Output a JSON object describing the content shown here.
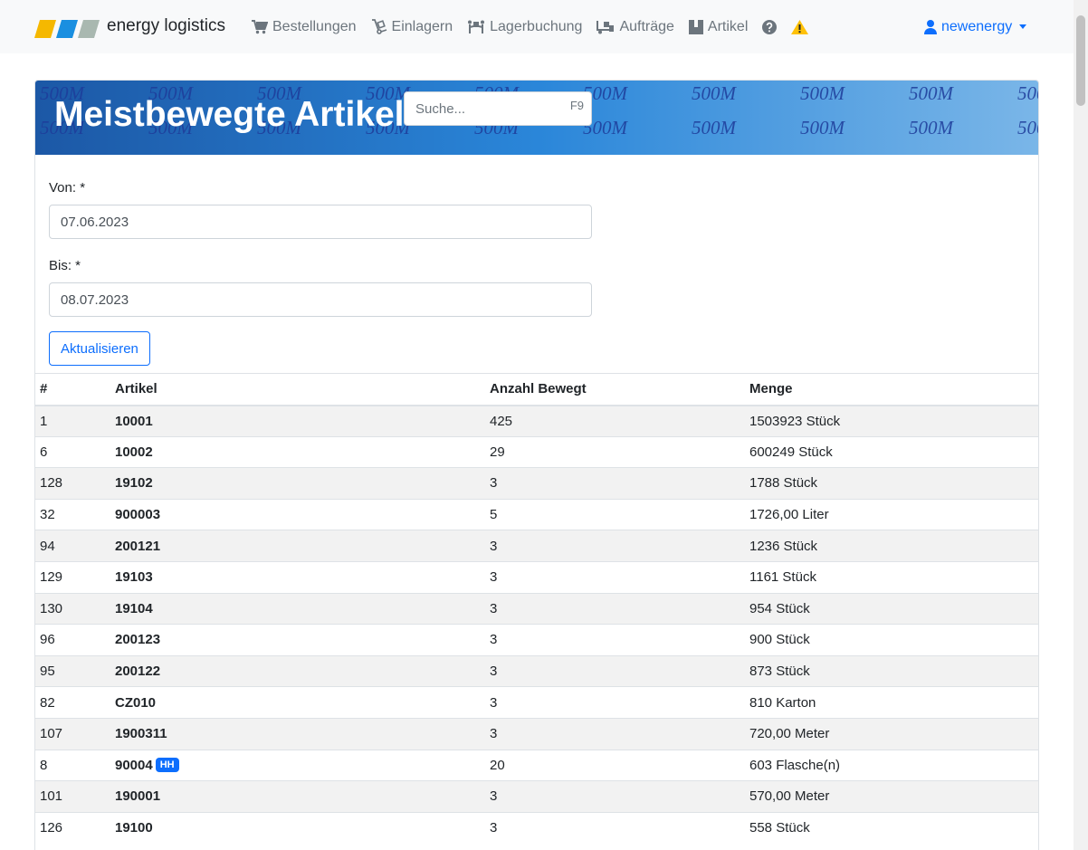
{
  "brand": {
    "name": "energy logistics",
    "colors": [
      "#f5b800",
      "#1a8fe0",
      "#a9b8b0"
    ]
  },
  "nav": [
    {
      "label": "Bestellungen",
      "icon": "cart-icon"
    },
    {
      "label": "Einlagern",
      "icon": "dolly-icon"
    },
    {
      "label": "Lagerbuchung",
      "icon": "people-carry-icon"
    },
    {
      "label": "Aufträge",
      "icon": "truck-loading-icon"
    },
    {
      "label": "Artikel",
      "icon": "box-icon"
    }
  ],
  "nav_icons": [
    "help-icon",
    "warning-icon"
  ],
  "user": {
    "name": "newenergy",
    "icon": "user-icon"
  },
  "banner": {
    "title": "Meistbewegte Artikel",
    "watermark": "500M"
  },
  "search": {
    "placeholder": "Suche...",
    "shortcut": "F9"
  },
  "form": {
    "from_label": "Von: *",
    "from_value": "07.06.2023",
    "to_label": "Bis: *",
    "to_value": "08.07.2023",
    "refresh_label": "Aktualisieren"
  },
  "table": {
    "headers": [
      "#",
      "Artikel",
      "Anzahl Bewegt",
      "Menge"
    ],
    "rows": [
      {
        "nr": "1",
        "artikel": "10001",
        "badge": "",
        "anzahl": "425",
        "menge": "1503923 Stück"
      },
      {
        "nr": "6",
        "artikel": "10002",
        "badge": "",
        "anzahl": "29",
        "menge": "600249 Stück"
      },
      {
        "nr": "128",
        "artikel": "19102",
        "badge": "",
        "anzahl": "3",
        "menge": "1788 Stück"
      },
      {
        "nr": "32",
        "artikel": "900003",
        "badge": "",
        "anzahl": "5",
        "menge": "1726,00 Liter"
      },
      {
        "nr": "94",
        "artikel": "200121",
        "badge": "",
        "anzahl": "3",
        "menge": "1236 Stück"
      },
      {
        "nr": "129",
        "artikel": "19103",
        "badge": "",
        "anzahl": "3",
        "menge": "1161 Stück"
      },
      {
        "nr": "130",
        "artikel": "19104",
        "badge": "",
        "anzahl": "3",
        "menge": "954 Stück"
      },
      {
        "nr": "96",
        "artikel": "200123",
        "badge": "",
        "anzahl": "3",
        "menge": "900 Stück"
      },
      {
        "nr": "95",
        "artikel": "200122",
        "badge": "",
        "anzahl": "3",
        "menge": "873 Stück"
      },
      {
        "nr": "82",
        "artikel": "CZ010",
        "badge": "",
        "anzahl": "3",
        "menge": "810 Karton"
      },
      {
        "nr": "107",
        "artikel": "1900311",
        "badge": "",
        "anzahl": "3",
        "menge": "720,00 Meter"
      },
      {
        "nr": "8",
        "artikel": "90004",
        "badge": "HH",
        "anzahl": "20",
        "menge": "603 Flasche(n)"
      },
      {
        "nr": "101",
        "artikel": "190001",
        "badge": "",
        "anzahl": "3",
        "menge": "570,00 Meter"
      },
      {
        "nr": "126",
        "artikel": "19100",
        "badge": "",
        "anzahl": "3",
        "menge": "558 Stück"
      }
    ]
  }
}
